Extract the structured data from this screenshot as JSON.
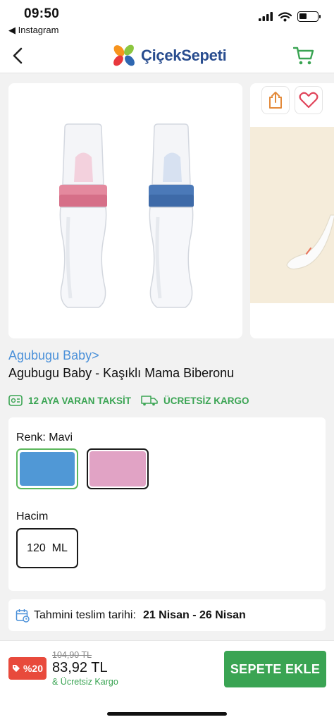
{
  "status_bar": {
    "time": "09:50",
    "back_app": "◀ Instagram"
  },
  "header": {
    "logo_text": "ÇiçekSepeti",
    "back_icon": "chevron-left-icon",
    "cart_icon": "cart-icon"
  },
  "gallery": {
    "share_icon": "share-icon",
    "favorite_icon": "heart-icon"
  },
  "product": {
    "brand_link": "Agubugu Baby>",
    "title": "Agubugu Baby - Kaşıklı Mama Biberonu"
  },
  "perks": [
    {
      "label": "12 AYA VARAN TAKSİT",
      "icon": "installment-icon"
    },
    {
      "label": "ÜCRETSİZ KARGO",
      "icon": "truck-icon"
    }
  ],
  "options": {
    "color_label": "Renk: Mavi",
    "colors": [
      {
        "name": "Mavi",
        "hex": "#5098d6",
        "selected": true
      },
      {
        "name": "Pembe",
        "hex": "#e1a3c5",
        "selected": false
      }
    ],
    "volume_label": "Hacim",
    "volume_value": "120  ML"
  },
  "delivery": {
    "label": "Tahmini teslim tarihi:",
    "dates": "21 Nisan - 26 Nisan"
  },
  "pricing": {
    "discount": "%20",
    "old_price": "104,90 TL",
    "new_price": "83,92 TL",
    "shipping_note": "& Ücretsiz Kargo",
    "add_to_cart_label": "SEPETE EKLE"
  },
  "colors": {
    "brand_green": "#3aa453",
    "link_blue": "#4a90d9",
    "discount_red": "#e84a3c",
    "logo_blue": "#294d8f"
  }
}
